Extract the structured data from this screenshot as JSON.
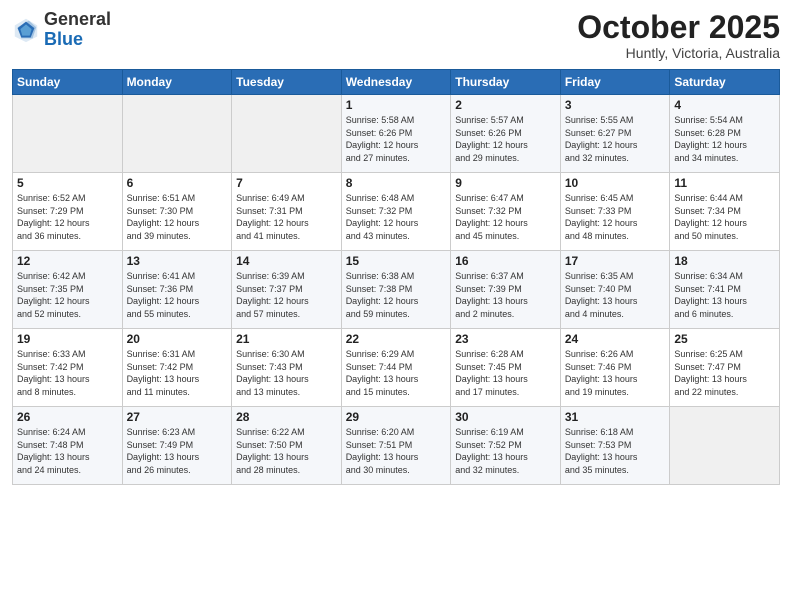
{
  "header": {
    "logo_general": "General",
    "logo_blue": "Blue",
    "month": "October 2025",
    "location": "Huntly, Victoria, Australia"
  },
  "weekdays": [
    "Sunday",
    "Monday",
    "Tuesday",
    "Wednesday",
    "Thursday",
    "Friday",
    "Saturday"
  ],
  "weeks": [
    [
      {
        "day": "",
        "info": ""
      },
      {
        "day": "",
        "info": ""
      },
      {
        "day": "",
        "info": ""
      },
      {
        "day": "1",
        "info": "Sunrise: 5:58 AM\nSunset: 6:26 PM\nDaylight: 12 hours\nand 27 minutes."
      },
      {
        "day": "2",
        "info": "Sunrise: 5:57 AM\nSunset: 6:26 PM\nDaylight: 12 hours\nand 29 minutes."
      },
      {
        "day": "3",
        "info": "Sunrise: 5:55 AM\nSunset: 6:27 PM\nDaylight: 12 hours\nand 32 minutes."
      },
      {
        "day": "4",
        "info": "Sunrise: 5:54 AM\nSunset: 6:28 PM\nDaylight: 12 hours\nand 34 minutes."
      }
    ],
    [
      {
        "day": "5",
        "info": "Sunrise: 6:52 AM\nSunset: 7:29 PM\nDaylight: 12 hours\nand 36 minutes."
      },
      {
        "day": "6",
        "info": "Sunrise: 6:51 AM\nSunset: 7:30 PM\nDaylight: 12 hours\nand 39 minutes."
      },
      {
        "day": "7",
        "info": "Sunrise: 6:49 AM\nSunset: 7:31 PM\nDaylight: 12 hours\nand 41 minutes."
      },
      {
        "day": "8",
        "info": "Sunrise: 6:48 AM\nSunset: 7:32 PM\nDaylight: 12 hours\nand 43 minutes."
      },
      {
        "day": "9",
        "info": "Sunrise: 6:47 AM\nSunset: 7:32 PM\nDaylight: 12 hours\nand 45 minutes."
      },
      {
        "day": "10",
        "info": "Sunrise: 6:45 AM\nSunset: 7:33 PM\nDaylight: 12 hours\nand 48 minutes."
      },
      {
        "day": "11",
        "info": "Sunrise: 6:44 AM\nSunset: 7:34 PM\nDaylight: 12 hours\nand 50 minutes."
      }
    ],
    [
      {
        "day": "12",
        "info": "Sunrise: 6:42 AM\nSunset: 7:35 PM\nDaylight: 12 hours\nand 52 minutes."
      },
      {
        "day": "13",
        "info": "Sunrise: 6:41 AM\nSunset: 7:36 PM\nDaylight: 12 hours\nand 55 minutes."
      },
      {
        "day": "14",
        "info": "Sunrise: 6:39 AM\nSunset: 7:37 PM\nDaylight: 12 hours\nand 57 minutes."
      },
      {
        "day": "15",
        "info": "Sunrise: 6:38 AM\nSunset: 7:38 PM\nDaylight: 12 hours\nand 59 minutes."
      },
      {
        "day": "16",
        "info": "Sunrise: 6:37 AM\nSunset: 7:39 PM\nDaylight: 13 hours\nand 2 minutes."
      },
      {
        "day": "17",
        "info": "Sunrise: 6:35 AM\nSunset: 7:40 PM\nDaylight: 13 hours\nand 4 minutes."
      },
      {
        "day": "18",
        "info": "Sunrise: 6:34 AM\nSunset: 7:41 PM\nDaylight: 13 hours\nand 6 minutes."
      }
    ],
    [
      {
        "day": "19",
        "info": "Sunrise: 6:33 AM\nSunset: 7:42 PM\nDaylight: 13 hours\nand 8 minutes."
      },
      {
        "day": "20",
        "info": "Sunrise: 6:31 AM\nSunset: 7:42 PM\nDaylight: 13 hours\nand 11 minutes."
      },
      {
        "day": "21",
        "info": "Sunrise: 6:30 AM\nSunset: 7:43 PM\nDaylight: 13 hours\nand 13 minutes."
      },
      {
        "day": "22",
        "info": "Sunrise: 6:29 AM\nSunset: 7:44 PM\nDaylight: 13 hours\nand 15 minutes."
      },
      {
        "day": "23",
        "info": "Sunrise: 6:28 AM\nSunset: 7:45 PM\nDaylight: 13 hours\nand 17 minutes."
      },
      {
        "day": "24",
        "info": "Sunrise: 6:26 AM\nSunset: 7:46 PM\nDaylight: 13 hours\nand 19 minutes."
      },
      {
        "day": "25",
        "info": "Sunrise: 6:25 AM\nSunset: 7:47 PM\nDaylight: 13 hours\nand 22 minutes."
      }
    ],
    [
      {
        "day": "26",
        "info": "Sunrise: 6:24 AM\nSunset: 7:48 PM\nDaylight: 13 hours\nand 24 minutes."
      },
      {
        "day": "27",
        "info": "Sunrise: 6:23 AM\nSunset: 7:49 PM\nDaylight: 13 hours\nand 26 minutes."
      },
      {
        "day": "28",
        "info": "Sunrise: 6:22 AM\nSunset: 7:50 PM\nDaylight: 13 hours\nand 28 minutes."
      },
      {
        "day": "29",
        "info": "Sunrise: 6:20 AM\nSunset: 7:51 PM\nDaylight: 13 hours\nand 30 minutes."
      },
      {
        "day": "30",
        "info": "Sunrise: 6:19 AM\nSunset: 7:52 PM\nDaylight: 13 hours\nand 32 minutes."
      },
      {
        "day": "31",
        "info": "Sunrise: 6:18 AM\nSunset: 7:53 PM\nDaylight: 13 hours\nand 35 minutes."
      },
      {
        "day": "",
        "info": ""
      }
    ]
  ]
}
